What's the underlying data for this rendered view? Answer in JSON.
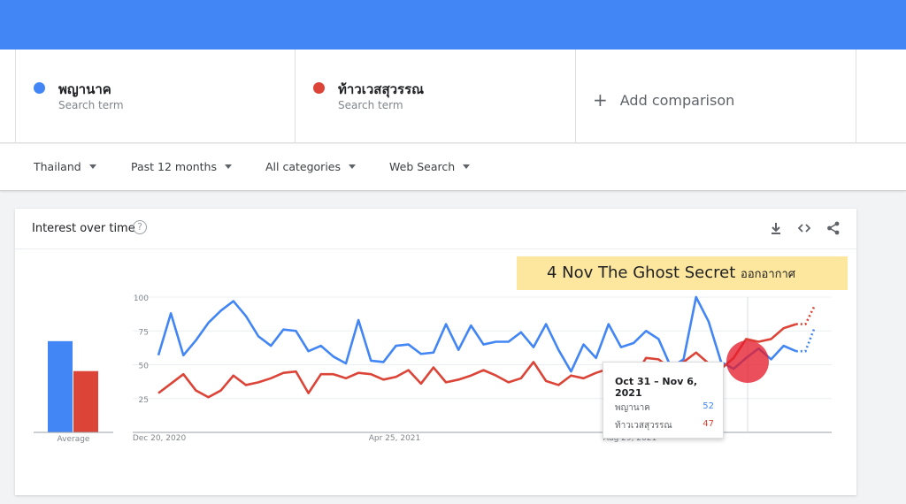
{
  "search_terms": [
    {
      "name": "พญานาค",
      "sub": "Search term",
      "color": "#4285f4"
    },
    {
      "name": "ท้าวเวสสุวรรณ",
      "sub": "Search term",
      "color": "#db4437"
    }
  ],
  "add_comparison": "Add comparison",
  "filters": [
    "Thailand",
    "Past 12 months",
    "All categories",
    "Web Search"
  ],
  "card": {
    "title": "Interest over time"
  },
  "banner": {
    "text": "4 Nov The Ghost Secret",
    "suffix": "ออกอากาศ"
  },
  "tooltip": {
    "date": "Oct 31 – Nov 6, 2021",
    "rows": [
      {
        "name": "พญานาค",
        "value": "52"
      },
      {
        "name": "ท้าวเวสสุวรรณ",
        "value": "47"
      }
    ]
  },
  "chart_data": {
    "type": "line",
    "x_ticks": [
      "Dec 20, 2020",
      "Apr 25, 2021",
      "Aug 29, 2021"
    ],
    "y_ticks": [
      25,
      50,
      75,
      100
    ],
    "ylim": [
      0,
      100
    ],
    "average": {
      "label": "Average",
      "values": [
        67,
        45
      ]
    },
    "series": [
      {
        "name": "พญานาค",
        "color": "#4285f4",
        "values": [
          57,
          88,
          57,
          68,
          81,
          90,
          97,
          86,
          71,
          64,
          76,
          75,
          60,
          64,
          56,
          51,
          83,
          53,
          52,
          64,
          65,
          58,
          59,
          80,
          61,
          79,
          65,
          67,
          67,
          74,
          63,
          80,
          61,
          45,
          65,
          55,
          80,
          63,
          66,
          75,
          69,
          48,
          54,
          100,
          82,
          52,
          47,
          55,
          62,
          54,
          64,
          60
        ],
        "projected": [
          60,
          78
        ]
      },
      {
        "name": "ท้าวเวสสุวรรณ",
        "color": "#db4437",
        "values": [
          29,
          36,
          43,
          31,
          26,
          31,
          42,
          35,
          37,
          40,
          44,
          45,
          29,
          43,
          43,
          40,
          44,
          43,
          39,
          41,
          46,
          36,
          48,
          37,
          39,
          42,
          46,
          42,
          37,
          40,
          52,
          38,
          35,
          42,
          40,
          44,
          47,
          49,
          40,
          55,
          54,
          47,
          52,
          59,
          51,
          47,
          55,
          69,
          67,
          69,
          77,
          80
        ],
        "projected": [
          80,
          94
        ]
      }
    ]
  }
}
